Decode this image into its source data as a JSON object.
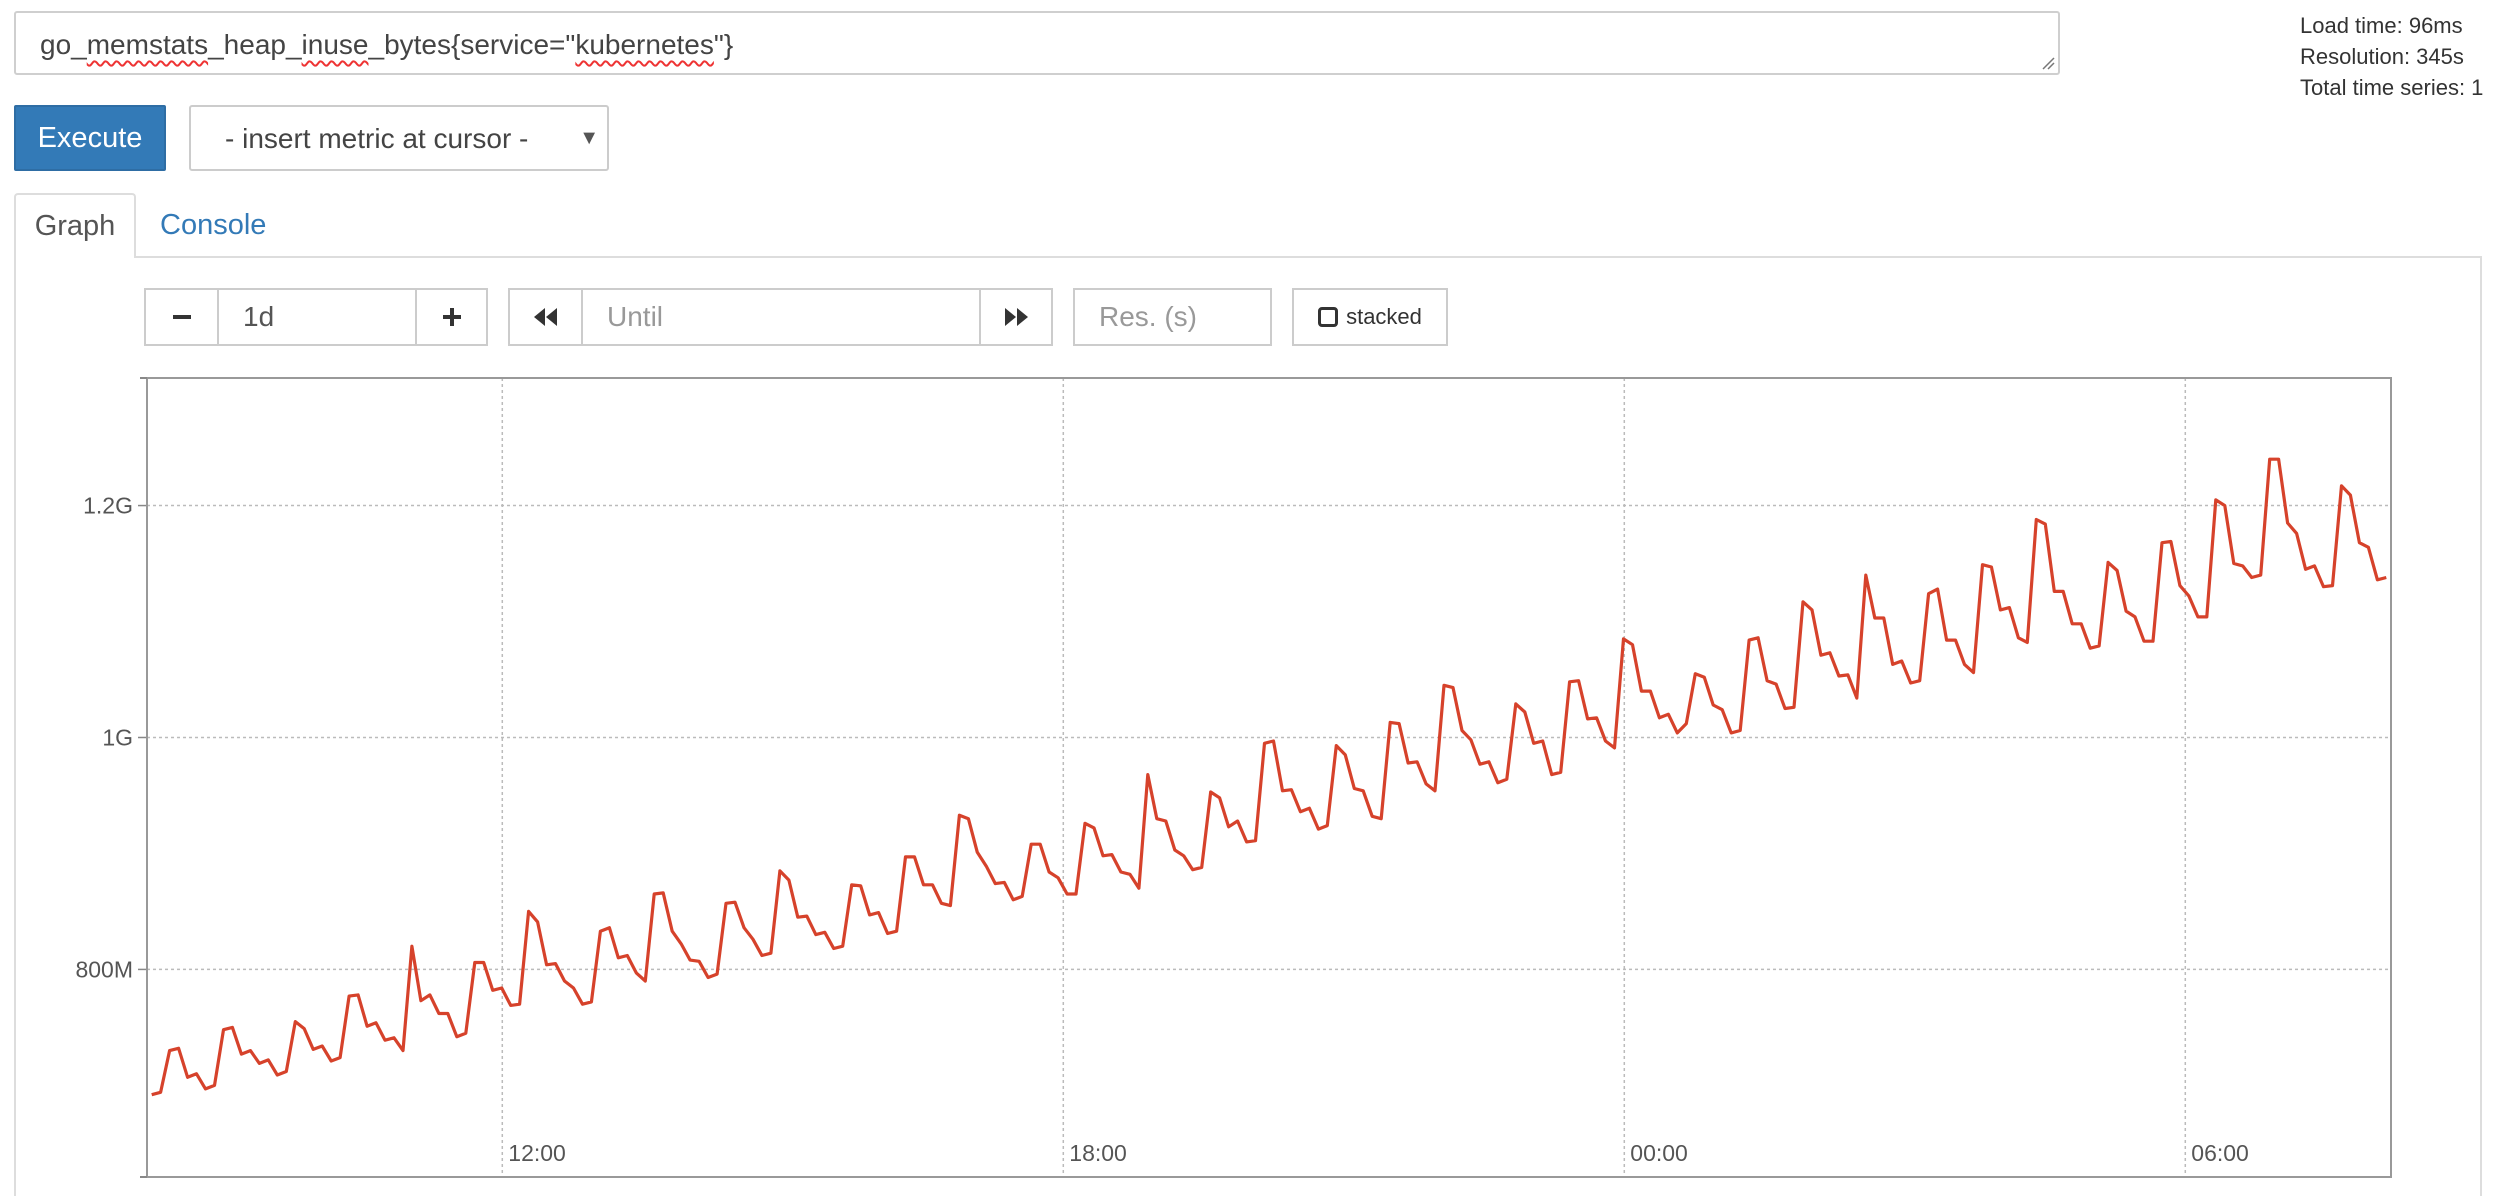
{
  "query": {
    "prefix": "go",
    "tok1": "memstats",
    "mid1": "heap",
    "tok2": "inuse",
    "mid2": "bytes{service=\"",
    "tok3": "kubernetes",
    "suffix": "\"}"
  },
  "stats": {
    "load_time": "Load time: 96ms",
    "resolution": "Resolution: 345s",
    "total_series": "Total time series: 1"
  },
  "execute_label": "Execute",
  "metric_select": {
    "selected": "- insert metric at cursor -"
  },
  "tabs": {
    "graph": "Graph",
    "console": "Console"
  },
  "controls": {
    "range_value": "1d",
    "until_placeholder": "Until",
    "res_placeholder": "Res. (s)",
    "stacked_label": "stacked"
  },
  "chart_data": {
    "type": "line",
    "y_ticks": [
      "800M",
      "1G",
      "1.2G"
    ],
    "y_tick_values": [
      800,
      1000,
      1200
    ],
    "x_ticks": [
      "12:00",
      "18:00",
      "00:00",
      "06:00"
    ],
    "x_tick_values": [
      12,
      18,
      24,
      30
    ],
    "xlim": [
      8.2,
      32.2
    ],
    "ylim": [
      621,
      1310
    ],
    "grid": true,
    "color": "#d6422b",
    "unit": "bytes (M)",
    "series": [
      {
        "y": [
          692,
          694,
          730,
          732,
          707,
          710,
          697,
          700,
          748,
          750,
          727,
          730,
          719,
          722,
          709,
          712,
          755,
          749,
          731,
          734,
          721,
          724,
          777,
          778,
          751,
          754,
          739,
          741,
          730,
          820,
          773,
          778,
          762,
          762,
          742,
          745,
          806,
          806,
          782,
          784,
          769,
          770,
          850,
          841,
          804,
          805,
          790,
          784,
          770,
          772,
          833,
          836,
          810,
          812,
          797,
          790,
          865,
          866,
          833,
          822,
          808,
          807,
          793,
          796,
          857,
          858,
          836,
          826,
          812,
          814,
          885,
          877,
          845,
          846,
          830,
          832,
          818,
          820,
          873,
          872,
          847,
          849,
          831,
          833,
          897,
          897,
          873,
          873,
          857,
          855,
          933,
          930,
          901,
          889,
          874,
          875,
          860,
          863,
          908,
          908,
          884,
          879,
          865,
          865,
          926,
          922,
          898,
          899,
          884,
          882,
          870,
          968,
          930,
          928,
          903,
          898,
          886,
          888,
          953,
          948,
          923,
          928,
          910,
          911,
          995,
          997,
          954,
          955,
          936,
          939,
          921,
          924,
          993,
          985,
          956,
          954,
          932,
          930,
          1013,
          1012,
          978,
          979,
          960,
          954,
          1045,
          1043,
          1006,
          998,
          977,
          979,
          961,
          964,
          1029,
          1022,
          995,
          997,
          968,
          970,
          1048,
          1049,
          1016,
          1017,
          997,
          991,
          1085,
          1080,
          1040,
          1040,
          1017,
          1020,
          1004,
          1012,
          1055,
          1052,
          1028,
          1024,
          1004,
          1006,
          1084,
          1086,
          1049,
          1046,
          1025,
          1026,
          1117,
          1110,
          1071,
          1073,
          1053,
          1054,
          1034,
          1140,
          1103,
          1103,
          1063,
          1066,
          1047,
          1049,
          1124,
          1128,
          1084,
          1084,
          1063,
          1056,
          1149,
          1147,
          1110,
          1112,
          1086,
          1082,
          1188,
          1184,
          1126,
          1126,
          1098,
          1098,
          1077,
          1079,
          1151,
          1144,
          1109,
          1104,
          1083,
          1083,
          1168,
          1169,
          1131,
          1122,
          1104,
          1104,
          1205,
          1200,
          1150,
          1148,
          1138,
          1140,
          1240,
          1240,
          1185,
          1176,
          1145,
          1148,
          1130,
          1131,
          1217,
          1209,
          1168,
          1164,
          1136,
          1138
        ]
      }
    ]
  }
}
